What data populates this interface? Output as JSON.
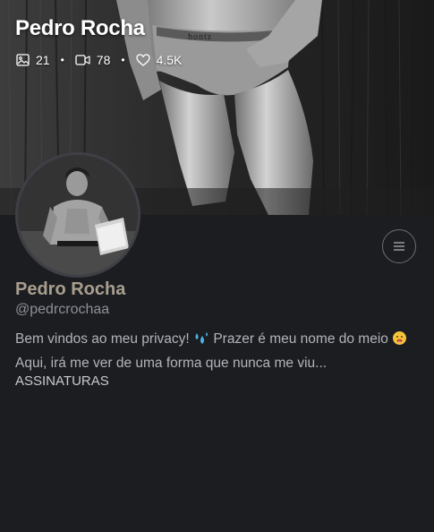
{
  "cover": {
    "title": "Pedro Rocha",
    "stats": {
      "images_icon": "image-icon",
      "images": "21",
      "videos_icon": "video-icon",
      "videos": "78",
      "likes_icon": "heart-icon",
      "likes": "4.5K",
      "separator": "•"
    }
  },
  "profile": {
    "name": "Pedro Rocha",
    "handle": "@pedrcrochaa",
    "bio_part1": "Bem vindos ao meu privacy! ",
    "bio_part2": " Prazer é meu nome do meio ",
    "bio_part3": " Aqui, irá me ver de uma forma que nunca me viu...",
    "menu_icon": "hamburger-menu-icon"
  },
  "subscriptions": {
    "label": "ASSINATURAS"
  },
  "colors": {
    "background": "#1c1d21",
    "name_color": "#a99f8f",
    "handle_color": "#8e9097",
    "bio_color": "#b2b4ba"
  }
}
